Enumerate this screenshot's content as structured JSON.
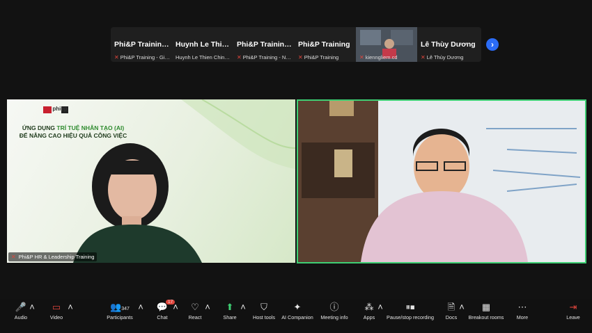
{
  "participant_strip": {
    "tiles": [
      {
        "name": "Phi&P  Training...",
        "label": "Phi&P Training - Giang"
      },
      {
        "name": "Huynh Le Thien...",
        "label": "Huynh Le Thien Chinh, P.C..."
      },
      {
        "name": "Phi&P  Training...",
        "label": "Phi&P Training - Ngoc"
      },
      {
        "name": "Phi&P Training",
        "label": "Phi&P Training"
      },
      {
        "name": "",
        "label": "kienngliem.cd"
      },
      {
        "name": "Lê Thùy Dương",
        "label": "Lê Thùy Dương"
      }
    ],
    "next_icon": "chevron-right-icon"
  },
  "main_videos": {
    "left": {
      "slide_logo_text": "phiep",
      "slide_line1_prefix": "ỨNG DỤNG ",
      "slide_line1_highlight": "TRÍ TUỆ NHÂN TẠO (AI)",
      "slide_line2": "ĐỂ NÂNG CAO HIỆU QUẢ CÔNG VIỆC",
      "name": "Phi&P HR & Leadership Training"
    },
    "right": {
      "active_speaker_color": "#3ecf73"
    }
  },
  "toolbar": {
    "audio": "Audio",
    "video": "Video",
    "participants": "Participants",
    "participants_count": "347",
    "chat": "Chat",
    "chat_badge": "17",
    "react": "React",
    "share": "Share",
    "host_tools": "Host tools",
    "ai_companion": "AI Companion",
    "meeting_info": "Meeting info",
    "apps": "Apps",
    "recording": "Pause/stop recording",
    "docs": "Docs",
    "breakout": "Breakout rooms",
    "more": "More",
    "leave": "Leave"
  }
}
